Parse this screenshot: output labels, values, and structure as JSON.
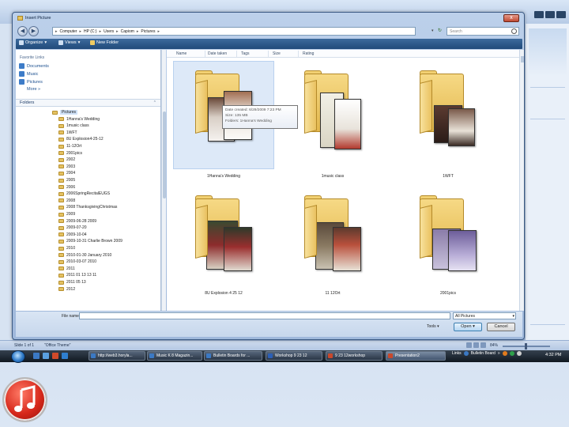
{
  "dialog": {
    "title": "Insert Picture",
    "address": [
      "Computer",
      "HP (C:)",
      "Users",
      "Capiom",
      "Pictures"
    ],
    "search_placeholder": "Search",
    "toolbar": {
      "organize": "Organize",
      "views": "Views",
      "new_folder": "New Folder"
    },
    "favorite_links_header": "Favorite Links",
    "favorites": [
      "Documents",
      "Music",
      "Pictures"
    ],
    "more": "More »",
    "folders_header": "Folders",
    "tree": [
      "Pictures",
      "1Hanna's Wedding",
      "1music class",
      "1WFT",
      "8U Explosion4-25-12",
      "11-12Ort",
      "2001pics",
      "2002",
      "2003",
      "2004",
      "2005",
      "2006",
      "2006SpringRecitalEUGS",
      "2008",
      "2008 ThanksgivingChristmas",
      "2009",
      "2009-06-28 2009",
      "2009-07-20",
      "2009-10-04",
      "2009-10-31 Charlie Brown 2009",
      "2010",
      "2010-01-30 January 2010",
      "2010-03-07 2010",
      "2011",
      "2011 01 13 13 11",
      "2011 05 13",
      "2012"
    ],
    "columns": [
      "Name",
      "Date taken",
      "Tags",
      "Size",
      "Rating"
    ],
    "items": [
      "1Hanna's Wedding",
      "1music class",
      "1WFT",
      "8U Explosion 4 25 12",
      "11 12Ort",
      "2001pics"
    ],
    "tooltip": {
      "line1": "Date created: 6/29/2009 7:23 PM",
      "line2": "Size: 135 MB",
      "line3": "Folders: 1Hanna's Wedding"
    },
    "file_name_label": "File name:",
    "file_type": "All Pictures",
    "tools": "Tools",
    "open": "Open",
    "cancel": "Cancel",
    "close_glyph": "x"
  },
  "app": {
    "status_slide": "Slide 1 of 1",
    "status_theme": "\"Office Theme\"",
    "zoom": "84%"
  },
  "taskbar": {
    "tasks": [
      "http://web3.horyla...",
      "Music K 8 Magazin...",
      "Bulletin Boards for ...",
      "Workshop 9 23 12",
      "9 23 12workshop",
      "Presentation2"
    ],
    "tray_links": "Links",
    "tray_board": "Bulletin Board",
    "clock": "4:32 PM"
  },
  "colors": {
    "accent": "#214a7a",
    "folder": "#e3b84e",
    "badge": "#d6281b"
  }
}
